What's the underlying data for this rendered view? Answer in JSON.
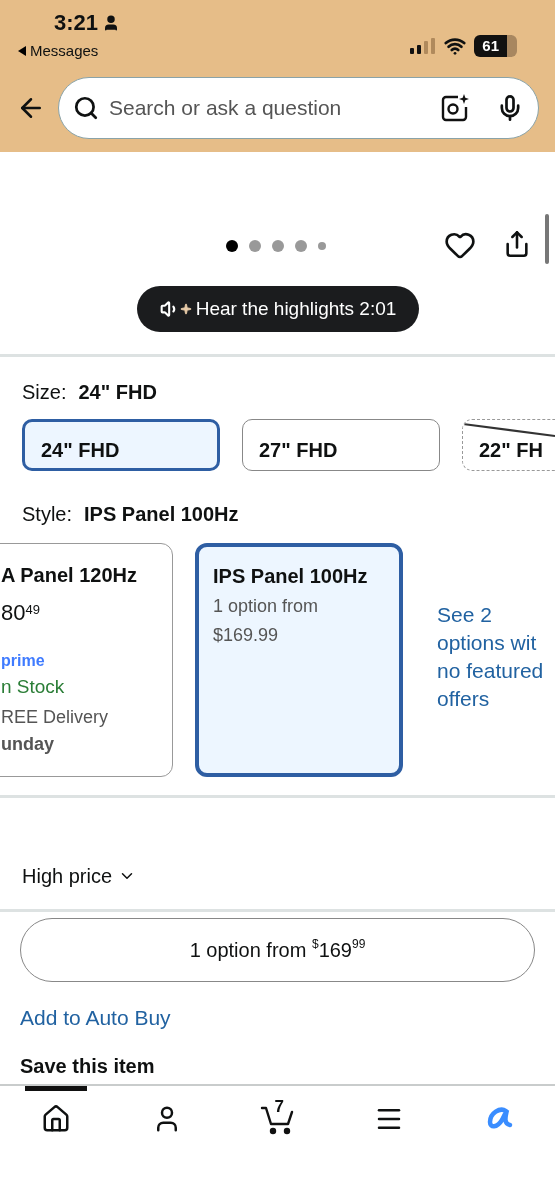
{
  "status_bar": {
    "time": "3:21",
    "back_label": "Messages",
    "battery": "61"
  },
  "search": {
    "placeholder": "Search or ask a question"
  },
  "gallery": {
    "dots": [
      {
        "selected": true,
        "kind": "dot"
      },
      {
        "selected": false,
        "kind": "dot"
      },
      {
        "selected": false,
        "kind": "dot"
      },
      {
        "selected": false,
        "kind": "dot"
      },
      {
        "selected": false,
        "kind": "small"
      }
    ],
    "favorite": false
  },
  "highlights_button": {
    "label": "Hear the highlights 2:01"
  },
  "size": {
    "label": "Size:",
    "value": "24\" FHD",
    "options": [
      {
        "label": "24\" FHD",
        "selected": true,
        "available": true
      },
      {
        "label": "27\" FHD",
        "selected": false,
        "available": true
      },
      {
        "label": "22\" FH",
        "selected": false,
        "available": false
      }
    ]
  },
  "style": {
    "label": "Style:",
    "value": "IPS Panel 100Hz",
    "options": [
      {
        "kind": "offer",
        "selected": false,
        "title": "A Panel 120Hz",
        "price_whole": "80",
        "price_fraction": "49",
        "prime": "prime",
        "stock": "n Stock",
        "delivery": "REE Delivery",
        "day": "unday"
      },
      {
        "kind": "summary",
        "selected": true,
        "title": "IPS Panel 100Hz",
        "lines": [
          "1 option from",
          "$169.99"
        ]
      },
      {
        "kind": "link",
        "selected": false,
        "lines": [
          "See 2",
          "options wit",
          "no featured",
          "offers"
        ]
      }
    ]
  },
  "price_filter": {
    "label": "High price"
  },
  "options_button": {
    "label": "1 option from",
    "currency": "$",
    "whole": "169",
    "fraction": "99"
  },
  "auto_buy_link": "Add to Auto Buy",
  "save_heading": "Save this item",
  "tab_bar": [
    {
      "kind": "home",
      "selected": true
    },
    {
      "kind": "account",
      "selected": false
    },
    {
      "kind": "cart",
      "selected": false,
      "count": "7"
    },
    {
      "kind": "menu",
      "selected": false
    },
    {
      "kind": "assistant",
      "selected": false
    }
  ]
}
